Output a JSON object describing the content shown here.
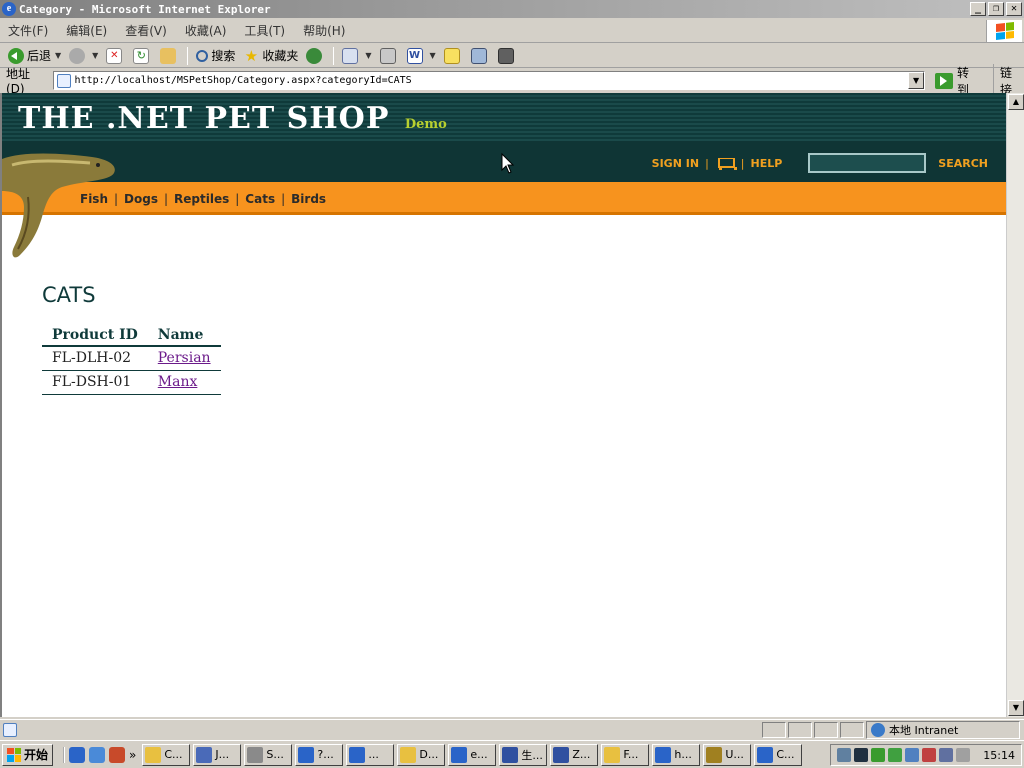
{
  "window": {
    "title": "Category - Microsoft Internet Explorer",
    "controls": [
      "_",
      "❐",
      "✕"
    ]
  },
  "menu": {
    "items": [
      "文件(F)",
      "编辑(E)",
      "查看(V)",
      "收藏(A)",
      "工具(T)",
      "帮助(H)"
    ]
  },
  "toolbar": {
    "back_label": "后退",
    "search_label": "搜索",
    "favorites_label": "收藏夹"
  },
  "address": {
    "label": "地址(D)",
    "url": "http://localhost/MSPetShop/Category.aspx?categoryId=CATS",
    "go_label": "转到",
    "links_label": "链接"
  },
  "site": {
    "logo": "THE .NET PET SHOP",
    "logo_suffix": "Demo",
    "signin_label": "SIGN IN",
    "help_label": "HELP",
    "search_label": "SEARCH",
    "search_value": "",
    "nav": [
      "Fish",
      "Dogs",
      "Reptiles",
      "Cats",
      "Birds"
    ],
    "nav_separator": "|"
  },
  "content": {
    "category_title": "CATS",
    "table": {
      "headers": [
        "Product ID",
        "Name"
      ],
      "rows": [
        {
          "id": "FL-DLH-02",
          "name": "Persian"
        },
        {
          "id": "FL-DSH-01",
          "name": "Manx"
        }
      ]
    }
  },
  "statusbar": {
    "zone": "本地 Intranet"
  },
  "taskbar": {
    "start_label": "开始",
    "quick_launch_more": "»",
    "tasks": [
      "C...",
      "J...",
      "S...",
      "?...",
      "...",
      "D...",
      "e...",
      "生...",
      "Z...",
      "F...",
      "h...",
      "U...",
      "C..."
    ],
    "clock": "15:14"
  }
}
